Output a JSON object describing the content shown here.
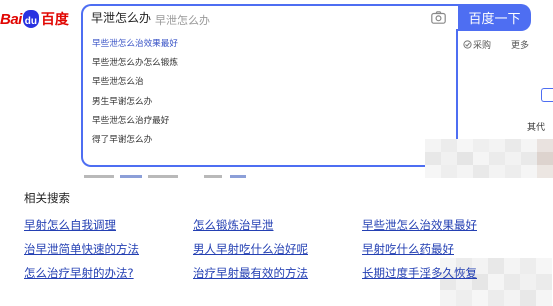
{
  "logo": {
    "text_bai": "Bai",
    "text_du": "du",
    "text_cn": "百度"
  },
  "search": {
    "query": "早泄怎么办",
    "hint": "早泄怎么办",
    "button_label": "百度一下"
  },
  "suggestions": [
    "早些泄怎么治效果最好",
    "早些泄怎么办怎么锻炼",
    "早些泄怎么治",
    "男生早谢怎么办",
    "早些泄怎么治疗最好",
    "得了早谢怎么办"
  ],
  "nav": {
    "tools": "采购",
    "more": "更多"
  },
  "side": {
    "fragment": "其代"
  },
  "related": {
    "title": "相关搜索",
    "links": [
      "早射怎么自我调理",
      "怎么锻炼治早泄",
      "早些泄怎么治效果最好",
      "治早泄简单快速的方法",
      "男人早射吃什么治好呢",
      "早射吃什么药最好",
      "怎么治疗早射的办法?",
      "治疗早射最有效的方法",
      "长期过度手淫多久恢复"
    ]
  },
  "colors": {
    "accent": "#4e6ef2",
    "link": "#2440b3",
    "logo_red": "#e10602",
    "logo_blue": "#2932e1"
  },
  "icons": {
    "camera": "camera-icon",
    "paw": "baidu-paw-icon"
  }
}
